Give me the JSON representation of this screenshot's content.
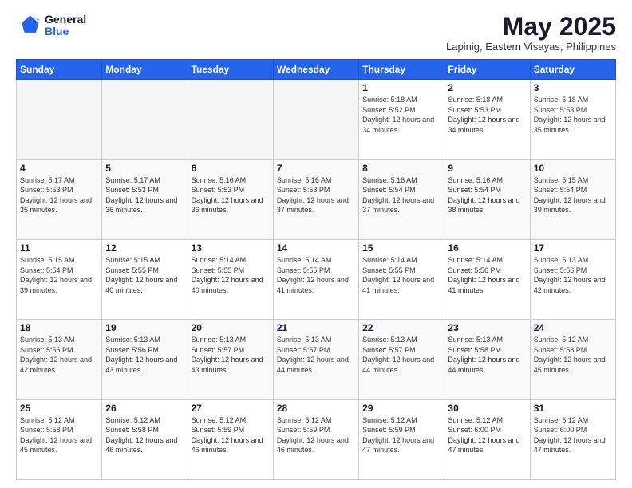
{
  "header": {
    "logo": {
      "general": "General",
      "blue": "Blue"
    },
    "title": "May 2025",
    "location": "Lapinig, Eastern Visayas, Philippines"
  },
  "weekdays": [
    "Sunday",
    "Monday",
    "Tuesday",
    "Wednesday",
    "Thursday",
    "Friday",
    "Saturday"
  ],
  "weeks": [
    [
      {
        "day": "",
        "empty": true
      },
      {
        "day": "",
        "empty": true
      },
      {
        "day": "",
        "empty": true
      },
      {
        "day": "",
        "empty": true
      },
      {
        "day": "1",
        "sunrise": "5:18 AM",
        "sunset": "5:52 PM",
        "daylight": "12 hours and 34 minutes."
      },
      {
        "day": "2",
        "sunrise": "5:18 AM",
        "sunset": "5:53 PM",
        "daylight": "12 hours and 34 minutes."
      },
      {
        "day": "3",
        "sunrise": "5:18 AM",
        "sunset": "5:53 PM",
        "daylight": "12 hours and 35 minutes."
      }
    ],
    [
      {
        "day": "4",
        "sunrise": "5:17 AM",
        "sunset": "5:53 PM",
        "daylight": "12 hours and 35 minutes."
      },
      {
        "day": "5",
        "sunrise": "5:17 AM",
        "sunset": "5:53 PM",
        "daylight": "12 hours and 36 minutes."
      },
      {
        "day": "6",
        "sunrise": "5:16 AM",
        "sunset": "5:53 PM",
        "daylight": "12 hours and 36 minutes."
      },
      {
        "day": "7",
        "sunrise": "5:16 AM",
        "sunset": "5:53 PM",
        "daylight": "12 hours and 37 minutes."
      },
      {
        "day": "8",
        "sunrise": "5:16 AM",
        "sunset": "5:54 PM",
        "daylight": "12 hours and 37 minutes."
      },
      {
        "day": "9",
        "sunrise": "5:16 AM",
        "sunset": "5:54 PM",
        "daylight": "12 hours and 38 minutes."
      },
      {
        "day": "10",
        "sunrise": "5:15 AM",
        "sunset": "5:54 PM",
        "daylight": "12 hours and 39 minutes."
      }
    ],
    [
      {
        "day": "11",
        "sunrise": "5:15 AM",
        "sunset": "5:54 PM",
        "daylight": "12 hours and 39 minutes."
      },
      {
        "day": "12",
        "sunrise": "5:15 AM",
        "sunset": "5:55 PM",
        "daylight": "12 hours and 40 minutes."
      },
      {
        "day": "13",
        "sunrise": "5:14 AM",
        "sunset": "5:55 PM",
        "daylight": "12 hours and 40 minutes."
      },
      {
        "day": "14",
        "sunrise": "5:14 AM",
        "sunset": "5:55 PM",
        "daylight": "12 hours and 41 minutes."
      },
      {
        "day": "15",
        "sunrise": "5:14 AM",
        "sunset": "5:55 PM",
        "daylight": "12 hours and 41 minutes."
      },
      {
        "day": "16",
        "sunrise": "5:14 AM",
        "sunset": "5:56 PM",
        "daylight": "12 hours and 41 minutes."
      },
      {
        "day": "17",
        "sunrise": "5:13 AM",
        "sunset": "5:56 PM",
        "daylight": "12 hours and 42 minutes."
      }
    ],
    [
      {
        "day": "18",
        "sunrise": "5:13 AM",
        "sunset": "5:56 PM",
        "daylight": "12 hours and 42 minutes."
      },
      {
        "day": "19",
        "sunrise": "5:13 AM",
        "sunset": "5:56 PM",
        "daylight": "12 hours and 43 minutes."
      },
      {
        "day": "20",
        "sunrise": "5:13 AM",
        "sunset": "5:57 PM",
        "daylight": "12 hours and 43 minutes."
      },
      {
        "day": "21",
        "sunrise": "5:13 AM",
        "sunset": "5:57 PM",
        "daylight": "12 hours and 44 minutes."
      },
      {
        "day": "22",
        "sunrise": "5:13 AM",
        "sunset": "5:57 PM",
        "daylight": "12 hours and 44 minutes."
      },
      {
        "day": "23",
        "sunrise": "5:13 AM",
        "sunset": "5:58 PM",
        "daylight": "12 hours and 44 minutes."
      },
      {
        "day": "24",
        "sunrise": "5:12 AM",
        "sunset": "5:58 PM",
        "daylight": "12 hours and 45 minutes."
      }
    ],
    [
      {
        "day": "25",
        "sunrise": "5:12 AM",
        "sunset": "5:58 PM",
        "daylight": "12 hours and 45 minutes."
      },
      {
        "day": "26",
        "sunrise": "5:12 AM",
        "sunset": "5:58 PM",
        "daylight": "12 hours and 46 minutes."
      },
      {
        "day": "27",
        "sunrise": "5:12 AM",
        "sunset": "5:59 PM",
        "daylight": "12 hours and 46 minutes."
      },
      {
        "day": "28",
        "sunrise": "5:12 AM",
        "sunset": "5:59 PM",
        "daylight": "12 hours and 46 minutes."
      },
      {
        "day": "29",
        "sunrise": "5:12 AM",
        "sunset": "5:59 PM",
        "daylight": "12 hours and 47 minutes."
      },
      {
        "day": "30",
        "sunrise": "5:12 AM",
        "sunset": "6:00 PM",
        "daylight": "12 hours and 47 minutes."
      },
      {
        "day": "31",
        "sunrise": "5:12 AM",
        "sunset": "6:00 PM",
        "daylight": "12 hours and 47 minutes."
      }
    ]
  ],
  "labels": {
    "sunrise": "Sunrise:",
    "sunset": "Sunset:",
    "daylight": "Daylight hours"
  }
}
